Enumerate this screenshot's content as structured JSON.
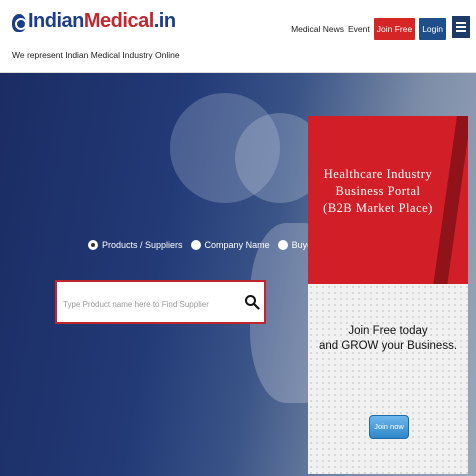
{
  "header": {
    "logo_text_1": "Indian",
    "logo_text_2": "Medical",
    "logo_text_3": ".in",
    "tagline": "We represent Indian Medical Industry Online",
    "nav": {
      "medical_news": "Medical News",
      "event": "Event",
      "join_free": "Join Free",
      "login": "Login"
    }
  },
  "search": {
    "options": [
      {
        "label": "Products / Suppliers",
        "selected": true
      },
      {
        "label": "Company Name",
        "selected": false
      },
      {
        "label": "Buyer",
        "selected": false
      }
    ],
    "placeholder": "Type Product name here to Find Supplier"
  },
  "promo": {
    "title_line1": "Healthcare Industry",
    "title_line2": "Business Portal",
    "title_line3": "(B2B Market Place)",
    "join_line1": "Join Free today",
    "join_line2": "and GROW your Business.",
    "button_label": "Join now"
  },
  "colors": {
    "brand_blue": "#1c3c8c",
    "brand_red": "#c1272d",
    "join_button": "#d62525",
    "login_button": "#1f4f8a"
  }
}
